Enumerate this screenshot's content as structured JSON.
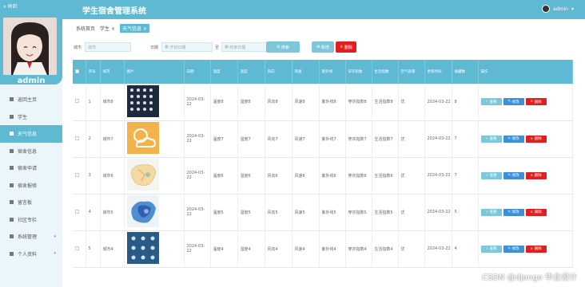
{
  "header": {
    "collapse_label": "« 收起",
    "app_title": "学生宿舍管理系统",
    "user_name": "admin"
  },
  "sidebar": {
    "avatar_name": "admin",
    "items": [
      {
        "label": "返回主页",
        "icon": "home-icon"
      },
      {
        "label": "学生",
        "icon": "user-icon"
      },
      {
        "label": "天气信息",
        "icon": "grid-icon",
        "active": true
      },
      {
        "label": "宿舍信息",
        "icon": "grid-icon"
      },
      {
        "label": "宿舍申请",
        "icon": "grid-icon"
      },
      {
        "label": "宿舍报修",
        "icon": "folder-icon"
      },
      {
        "label": "留言板",
        "icon": "grid-icon"
      },
      {
        "label": "社区专栏",
        "icon": "grid-icon"
      },
      {
        "label": "系统管理",
        "icon": "settings-icon",
        "arrow": true
      },
      {
        "label": "个人资料",
        "icon": "grid-icon",
        "arrow": true
      }
    ]
  },
  "breadcrumb": {
    "home": "系统首页",
    "tab1": "学生",
    "tab2": "天气信息"
  },
  "search": {
    "city_label": "城市",
    "city_placeholder": "城市",
    "date_label": "日期",
    "date_start_placeholder": "开始日期",
    "to_label": "至",
    "date_end_placeholder": "结束日期",
    "search_button": "搜索",
    "add_button": "新增",
    "delete_button": "删除"
  },
  "table": {
    "headers": [
      "",
      "序号",
      "城市",
      "图片",
      "日期",
      "温度",
      "湿度",
      "风向",
      "风速",
      "紫外线",
      "穿衣指数",
      "生活指数",
      "空气质量",
      "更新时间",
      "收藏数",
      "操作"
    ],
    "rows": [
      {
        "no": "1",
        "city": "城市8",
        "date": "2024-03-22",
        "temp": "温度8",
        "hum": "湿度8",
        "wind_dir": "风向8",
        "wind_speed": "风速8",
        "uv": "紫外线8",
        "dress": "穿衣指数8",
        "life": "生活指数8",
        "air": "优",
        "updated": "2024-03-22",
        "fav": "8"
      },
      {
        "no": "2",
        "city": "城市7",
        "date": "2024-03-22",
        "temp": "温度7",
        "hum": "湿度7",
        "wind_dir": "风向7",
        "wind_speed": "风速7",
        "uv": "紫外线7",
        "dress": "穿衣指数7",
        "life": "生活指数7",
        "air": "优",
        "updated": "2024-03-22",
        "fav": "7"
      },
      {
        "no": "3",
        "city": "城市6",
        "date": "2024-03-22",
        "temp": "温度6",
        "hum": "湿度6",
        "wind_dir": "风向6",
        "wind_speed": "风速6",
        "uv": "紫外线6",
        "dress": "穿衣指数6",
        "life": "生活指数6",
        "air": "优",
        "updated": "2024-03-22",
        "fav": "7"
      },
      {
        "no": "4",
        "city": "城市5",
        "date": "2024-03-22",
        "temp": "温度5",
        "hum": "湿度5",
        "wind_dir": "风向5",
        "wind_speed": "风速5",
        "uv": "紫外线5",
        "dress": "穿衣指数5",
        "life": "生活指数5",
        "air": "优",
        "updated": "2024-03-22",
        "fav": "5"
      },
      {
        "no": "5",
        "city": "城市4",
        "date": "2024-03-22",
        "temp": "温度4",
        "hum": "湿度4",
        "wind_dir": "风向4",
        "wind_speed": "风速4",
        "uv": "紫外线4",
        "dress": "穿衣指数4",
        "life": "生活指数4",
        "air": "优",
        "updated": "2024-03-22",
        "fav": "4"
      }
    ],
    "action_view": "查看",
    "action_edit": "修改",
    "action_delete": "删除"
  },
  "watermark": "CSDN @django 毕业设计",
  "colors": {
    "primary": "#5fb9d3",
    "danger": "#e02020",
    "edit": "#3d8fd8"
  }
}
